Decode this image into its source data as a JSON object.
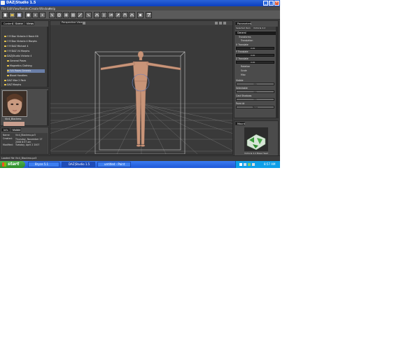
{
  "window": {
    "title": "DAZ|Studio 1.5"
  },
  "menu": [
    "File",
    "Edit",
    "View",
    "Render",
    "Create",
    "Window",
    "Help"
  ],
  "left_panel": {
    "tabs": [
      "Content",
      "Scene",
      "Views"
    ],
    "tree": [
      "!!!!!Daz Victoria 4 Basic Kit",
      "!!!!!Daz Victoria 4 Morphs",
      "!!!!!DAZ Michael 4",
      "!!!!!DAZ V4 Morphs",
      "DAZ|Studio Victoria 4",
      "General Poses",
      "Magnetics Clothing",
      "!V4 Poses Genesis",
      "Blood Handlers",
      "DAZ Vibe 2 Pack",
      "DAZ Morphs"
    ],
    "thumbnail_caption": "Vic4_Blackmo",
    "info_tabs": [
      "Info",
      "Visible"
    ],
    "info": [
      {
        "key": "Name:",
        "value": "Vic4_Blackmo.pz3"
      },
      {
        "key": "Created:",
        "value": "Thursday, November 27 2008 8:57 am"
      },
      {
        "key": "Modified:",
        "value": "Tuesday, April 2 2007"
      }
    ]
  },
  "viewport": {
    "label": "Perspective View",
    "tooltip": "DAZ|Studio 1.5"
  },
  "right_panel": {
    "tab": "Parameters",
    "subheader_left": "Selected Item",
    "subheader_right": "Victoria 4.2",
    "general": "General",
    "groups": [
      "Transforms",
      "Translation",
      "Rotation",
      "Scale",
      "Misc"
    ],
    "sliders": [
      {
        "label": "X Translate",
        "value": "0.00"
      },
      {
        "label": "Y Translate",
        "value": "0.00"
      },
      {
        "label": "Z Translate",
        "value": "0.00"
      }
    ],
    "fields": [
      {
        "label": "Visible",
        "value": "On"
      },
      {
        "label": "Selectable",
        "value": "On"
      },
      {
        "label": "Cast Shadows",
        "value": "On"
      },
      {
        "label": "Point At",
        "value": "None"
      }
    ],
    "preview_tab": "Mount",
    "preview_caption": "Victoria 4.2 Base Head"
  },
  "status_bar": "Loaded file Vic4_Blackmo.pz3",
  "taskbar": {
    "start": "start",
    "tasks": [
      "Bryce 5.1",
      "DAZ|Studio 1.5",
      "untitled - Paint"
    ],
    "clock": "8:57 AM"
  },
  "colors": {
    "accent": "#2a63d8",
    "viewport_bg": "#3a3a3a",
    "figure": "#c89478",
    "selection_blue": "#6a7fa8"
  }
}
